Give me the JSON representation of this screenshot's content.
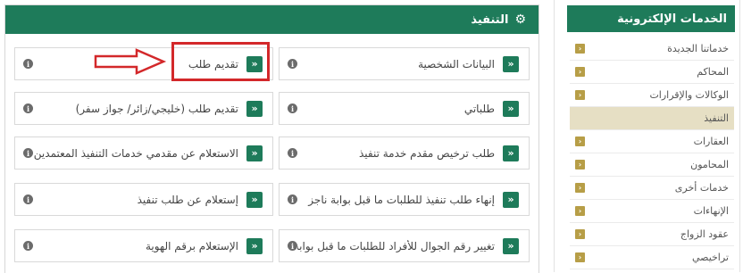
{
  "main": {
    "title": "التنفيذ",
    "icon": "gear-icon",
    "right_column": [
      "البيانات الشخصية",
      "طلباتي",
      "طلب ترخيص مقدم خدمة تنفيذ",
      "إنهاء طلب تنفيذ للطلبات ما قبل بوابة ناجز",
      "تغيير رقم الجوال للأفراد للطلبات ما قبل بوابة ناجز"
    ],
    "left_column": [
      "تقديم طلب",
      "تقديم طلب (خليجي/زائر/ جواز سفر)",
      "الاستعلام عن مقدمي خدمات التنفيذ المعتمدين",
      "إستعلام عن طلب تنفيذ",
      "الإستعلام برقم الهوية"
    ],
    "chevron_glyph": "«",
    "info_glyph": "i"
  },
  "sidebar": {
    "title": "الخدمات الإلكترونية",
    "items": [
      "خدماتنا الجديدة",
      "المحاكم",
      "الوكالات والإقرارات",
      "التنفيذ",
      "العقارات",
      "المحامون",
      "خدمات أخرى",
      "الإنهاءات",
      "عقود الزواج",
      "تراخيصي"
    ],
    "active_item": "التنفيذ",
    "chevron_glyph": "‹"
  },
  "colors": {
    "header_green": "#1e7b5a",
    "sidebar_chevron_gold": "#b79e47",
    "active_bg": "#e6dfc4",
    "annotation_red": "#d3282a"
  }
}
